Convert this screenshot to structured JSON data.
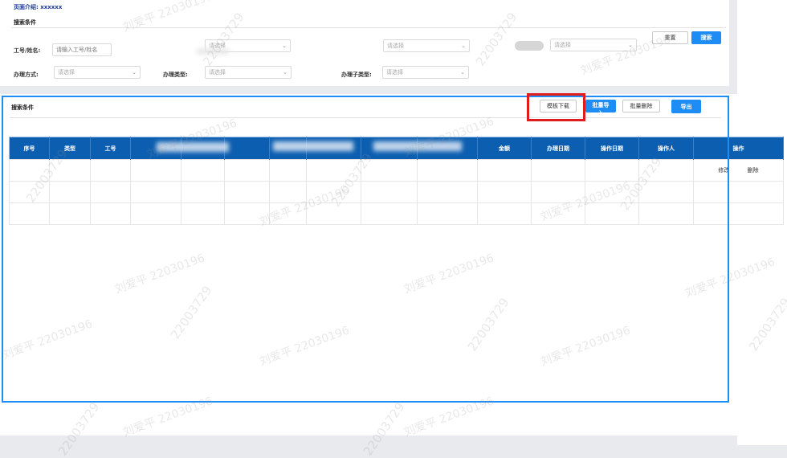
{
  "intro": {
    "label": "页面介绍:",
    "value": "xxxxxx"
  },
  "search_section": {
    "title": "搜索条件",
    "fields": {
      "employee": {
        "label": "工号/姓名:",
        "placeholder": "请输入工号/姓名"
      },
      "select_placeholder": "请选择",
      "method": {
        "label": "办理方式:"
      },
      "type": {
        "label": "办理类型:"
      },
      "subtype": {
        "label": "办理子类型:"
      }
    },
    "reset_label": "重置",
    "search_label": "搜索"
  },
  "list_section": {
    "title": "搜索条件",
    "buttons": {
      "template_download": "模板下载",
      "batch_import": "批量导入",
      "batch_delete": "批量删除",
      "export": "导出"
    },
    "columns": [
      "序号",
      "类型",
      "工号",
      "",
      "",
      "",
      "",
      "",
      "",
      "",
      "金额",
      "办理日期",
      "操作日期",
      "操作人",
      "操作"
    ],
    "row_actions": {
      "edit": "修改",
      "delete": "删除"
    }
  },
  "watermark": {
    "name": "刘爱平 22030196",
    "number": "22003729"
  },
  "colors": {
    "primary": "#1e8cf5",
    "table_header": "#0c5eb0",
    "highlight_red": "#e01c1c"
  }
}
